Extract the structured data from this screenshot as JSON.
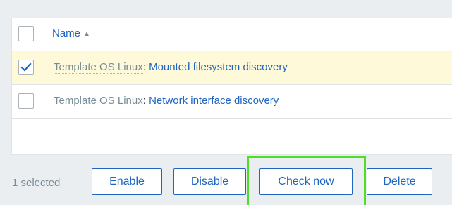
{
  "table": {
    "header": {
      "name_label": "Name",
      "sort_glyph": "▲"
    },
    "rows": [
      {
        "template": "Template OS Linux",
        "separator": ":",
        "name": " Mounted filesystem discovery",
        "checked": true
      },
      {
        "template": "Template OS Linux",
        "separator": ":",
        "name": " Network interface discovery",
        "checked": false
      }
    ]
  },
  "footer": {
    "selected_text": "1 selected",
    "buttons": {
      "enable": "Enable",
      "disable": "Disable",
      "check_now": "Check now",
      "delete": "Delete"
    }
  },
  "colors": {
    "link": "#1f65c0",
    "muted": "#768d99",
    "selected_row_bg": "#fef9d9",
    "highlight": "#4dde2a"
  }
}
